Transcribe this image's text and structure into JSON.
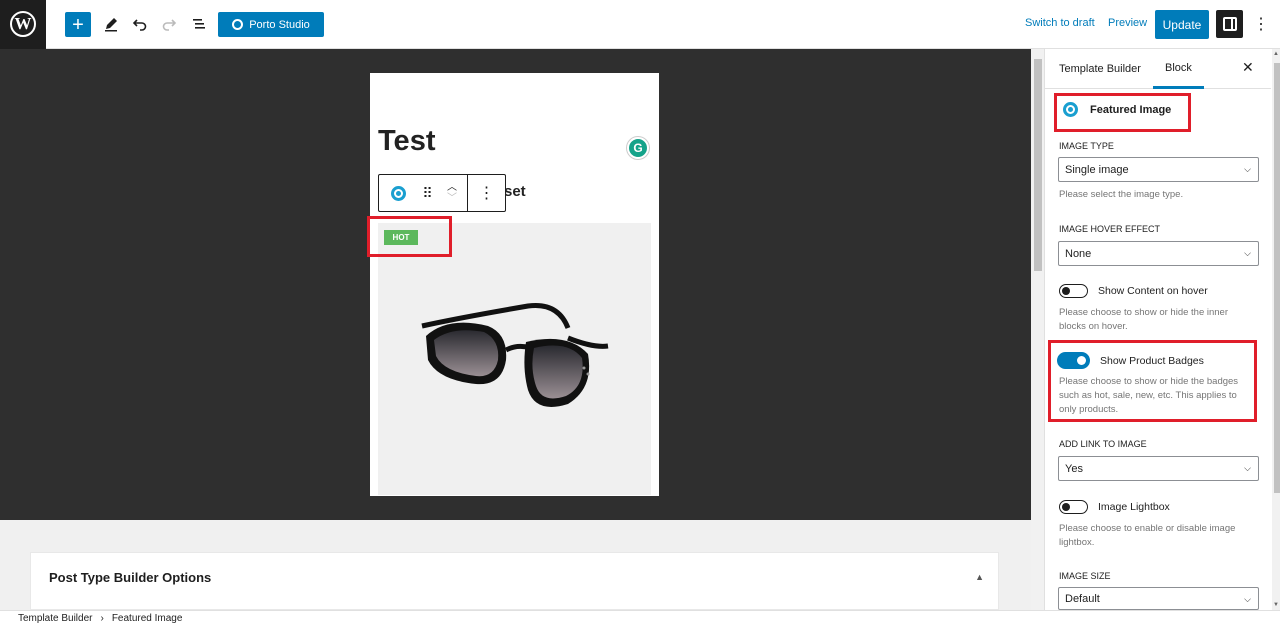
{
  "topbar": {
    "porto_label": "Porto Studio",
    "switch_to_draft": "Switch to draft",
    "preview": "Preview",
    "update": "Update"
  },
  "editor": {
    "page_title": "Test",
    "subtitle_fragment": "set",
    "badge": "HOT"
  },
  "meta_box": {
    "title": "Post Type Builder Options"
  },
  "sidebar": {
    "tabs": [
      "Template Builder",
      "Block"
    ],
    "active_tab": "Block",
    "block_title": "Featured Image",
    "image_type": {
      "label": "IMAGE TYPE",
      "value": "Single image",
      "help": "Please select the image type."
    },
    "hover_effect": {
      "label": "IMAGE HOVER EFFECT",
      "value": "None"
    },
    "show_content_hover": {
      "label": "Show Content on hover",
      "help": "Please choose to show or hide the inner blocks on hover.",
      "on": false
    },
    "show_badges": {
      "label": "Show Product Badges",
      "help": "Please choose to show or hide the badges such as hot, sale, new, etc. This applies to only products.",
      "on": true
    },
    "add_link": {
      "label": "ADD LINK TO IMAGE",
      "value": "Yes"
    },
    "lightbox": {
      "label": "Image Lightbox",
      "help": "Please choose to enable or disable image lightbox.",
      "on": false
    },
    "image_size": {
      "label": "IMAGE SIZE",
      "value": "Default"
    }
  },
  "breadcrumb": [
    "Template Builder",
    "Featured Image"
  ],
  "colors": {
    "accent": "#007cba",
    "highlight": "#e01e2a",
    "badge": "#5cb85c"
  }
}
